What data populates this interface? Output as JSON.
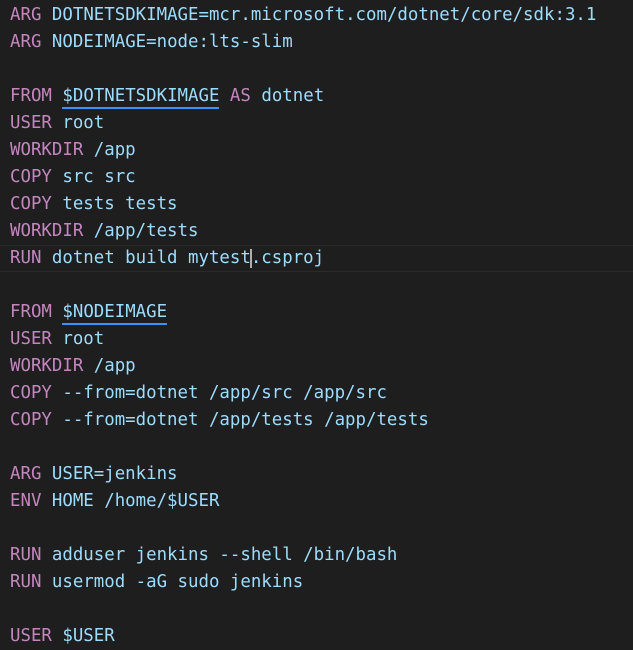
{
  "colors": {
    "background": "#1e1e1e",
    "keyword": "#c586c0",
    "variable": "#9cdcfe",
    "text": "#d4d4d4",
    "underline": "#3794ff"
  },
  "editor": {
    "language": "dockerfile",
    "lines": [
      {
        "tokens": [
          {
            "t": "ARG",
            "c": "kw"
          },
          {
            "t": " ",
            "c": "plain"
          },
          {
            "t": "DOTNETSDKIMAGE=mcr.microsoft.com/dotnet/core/sdk:3.1",
            "c": "var"
          }
        ]
      },
      {
        "tokens": [
          {
            "t": "ARG",
            "c": "kw"
          },
          {
            "t": " ",
            "c": "plain"
          },
          {
            "t": "NODEIMAGE=node:lts-slim",
            "c": "var"
          }
        ]
      },
      {
        "tokens": []
      },
      {
        "tokens": [
          {
            "t": "FROM",
            "c": "kw"
          },
          {
            "t": " ",
            "c": "plain"
          },
          {
            "t": "$DOTNETSDKIMAGE",
            "c": "var",
            "u": true
          },
          {
            "t": " ",
            "c": "plain"
          },
          {
            "t": "AS",
            "c": "kw"
          },
          {
            "t": " dotnet",
            "c": "var"
          }
        ]
      },
      {
        "tokens": [
          {
            "t": "USER",
            "c": "kw"
          },
          {
            "t": " root",
            "c": "var"
          }
        ]
      },
      {
        "tokens": [
          {
            "t": "WORKDIR",
            "c": "kw"
          },
          {
            "t": " /app",
            "c": "var"
          }
        ]
      },
      {
        "tokens": [
          {
            "t": "COPY",
            "c": "kw"
          },
          {
            "t": " src src",
            "c": "var"
          }
        ]
      },
      {
        "tokens": [
          {
            "t": "COPY",
            "c": "kw"
          },
          {
            "t": " tests tests",
            "c": "var"
          }
        ]
      },
      {
        "tokens": [
          {
            "t": "WORKDIR",
            "c": "kw"
          },
          {
            "t": " /app/tests",
            "c": "var"
          }
        ]
      },
      {
        "current": true,
        "tokens": [
          {
            "t": "RUN",
            "c": "kw"
          },
          {
            "t": " dotnet build mytest",
            "c": "var"
          },
          {
            "t": "",
            "c": "cursor"
          },
          {
            "t": ".csproj",
            "c": "var"
          }
        ]
      },
      {
        "tokens": []
      },
      {
        "tokens": [
          {
            "t": "FROM",
            "c": "kw"
          },
          {
            "t": " ",
            "c": "plain"
          },
          {
            "t": "$NODEIMAGE",
            "c": "var",
            "u": true
          }
        ]
      },
      {
        "tokens": [
          {
            "t": "USER",
            "c": "kw"
          },
          {
            "t": " root",
            "c": "var"
          }
        ]
      },
      {
        "tokens": [
          {
            "t": "WORKDIR",
            "c": "kw"
          },
          {
            "t": " /app",
            "c": "var"
          }
        ]
      },
      {
        "tokens": [
          {
            "t": "COPY",
            "c": "kw"
          },
          {
            "t": " --from=dotnet /app/src /app/src",
            "c": "var"
          }
        ]
      },
      {
        "tokens": [
          {
            "t": "COPY",
            "c": "kw"
          },
          {
            "t": " --from=dotnet /app/tests /app/tests",
            "c": "var"
          }
        ]
      },
      {
        "tokens": []
      },
      {
        "tokens": [
          {
            "t": "ARG",
            "c": "kw"
          },
          {
            "t": " USER=jenkins",
            "c": "var"
          }
        ]
      },
      {
        "tokens": [
          {
            "t": "ENV",
            "c": "kw"
          },
          {
            "t": " HOME /home/$USER",
            "c": "var"
          }
        ]
      },
      {
        "tokens": []
      },
      {
        "tokens": [
          {
            "t": "RUN",
            "c": "kw"
          },
          {
            "t": " adduser jenkins --shell /bin/bash",
            "c": "var"
          }
        ]
      },
      {
        "tokens": [
          {
            "t": "RUN",
            "c": "kw"
          },
          {
            "t": " usermod -aG sudo jenkins",
            "c": "var"
          }
        ]
      },
      {
        "tokens": []
      },
      {
        "tokens": [
          {
            "t": "USER",
            "c": "kw"
          },
          {
            "t": " $USER",
            "c": "var"
          }
        ]
      }
    ]
  }
}
